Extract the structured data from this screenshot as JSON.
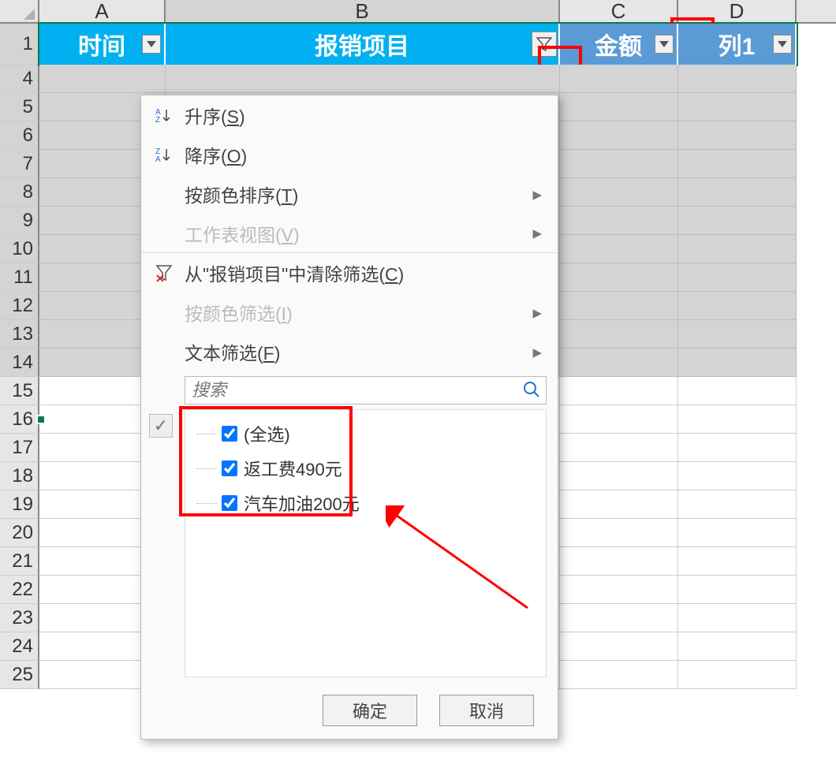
{
  "columns": {
    "letters": [
      "A",
      "B",
      "C",
      "D"
    ],
    "widths": [
      160,
      500,
      150,
      150
    ],
    "selected_index": 1
  },
  "row_numbers": [
    1,
    4,
    5,
    6,
    7,
    8,
    9,
    10,
    11,
    12,
    13,
    14,
    15,
    16,
    17,
    18,
    19,
    20,
    21,
    22,
    23,
    24,
    25
  ],
  "greyed_rows_count": 11,
  "header_cells": [
    {
      "label": "时间",
      "style": "blue",
      "filter_type": "dropdown"
    },
    {
      "label": "报销项目",
      "style": "blue",
      "filter_type": "funnel"
    },
    {
      "label": "金额",
      "style": "dblue",
      "filter_type": "dropdown"
    },
    {
      "label": "列1",
      "style": "dblue",
      "filter_type": "dropdown"
    }
  ],
  "menu": {
    "sort_asc": {
      "text": "升序(",
      "key": "S",
      "suffix": ")"
    },
    "sort_desc": {
      "text": "降序(",
      "key": "O",
      "suffix": ")"
    },
    "sort_color": {
      "text": "按颜色排序(",
      "key": "T",
      "suffix": ")"
    },
    "sheet_view": {
      "text": "工作表视图(",
      "key": "V",
      "suffix": ")"
    },
    "clear_filter": {
      "text": "从\"报销项目\"中清除筛选(",
      "key": "C",
      "suffix": ")"
    },
    "color_filter": {
      "text": "按颜色筛选(",
      "key": "I",
      "suffix": ")"
    },
    "text_filter": {
      "text": "文本筛选(",
      "key": "F",
      "suffix": ")"
    },
    "search_placeholder": "搜索",
    "check_items": [
      {
        "label": "(全选)",
        "checked": true
      },
      {
        "label": "返工费490元",
        "checked": true
      },
      {
        "label": "汽车加油200元",
        "checked": true
      }
    ]
  },
  "buttons": {
    "ok": "确定",
    "cancel": "取消"
  }
}
